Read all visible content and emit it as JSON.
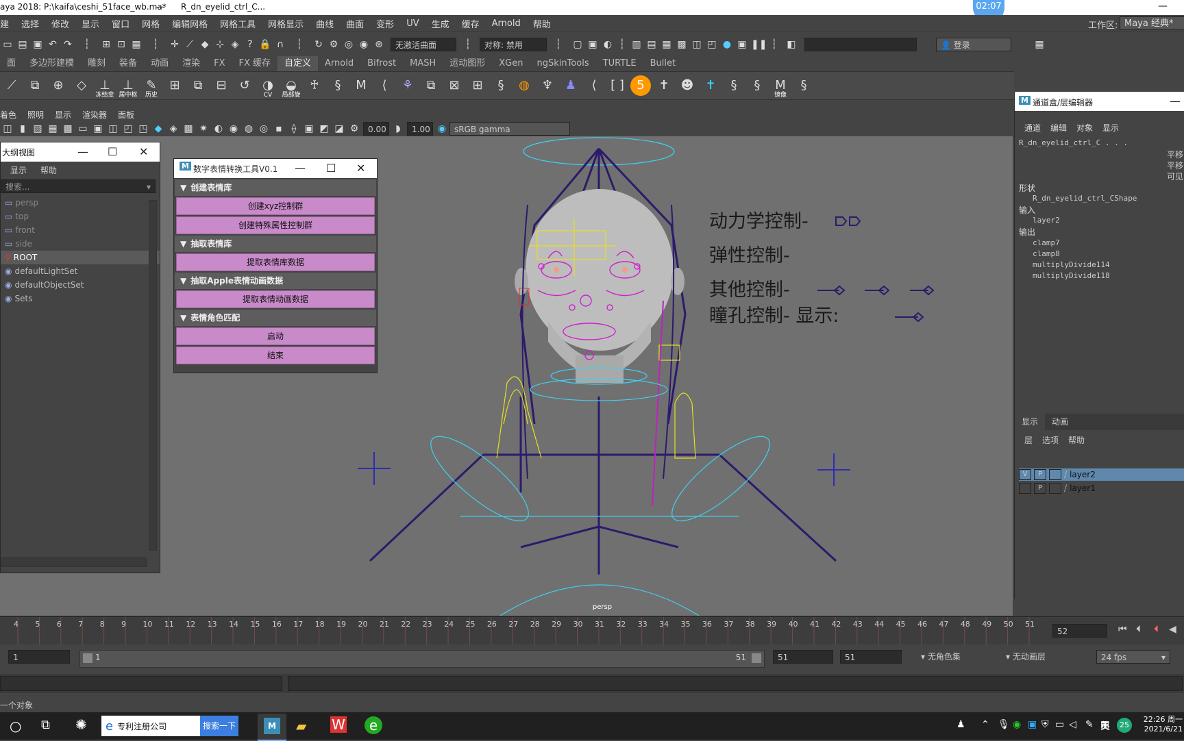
{
  "titlebar": {
    "app": "aya 2018: P:\\kaifa\\ceshi_51face_wb.ma*",
    "sep": "---",
    "node": "R_dn_eyelid_ctrl_C...",
    "workspace_label": "工作区:",
    "workspace_value": "Maya 经典*",
    "clock": "02:07"
  },
  "menubar": {
    "items": [
      "建",
      "选择",
      "修改",
      "显示",
      "窗口",
      "网格",
      "编辑网格",
      "网格工具",
      "网格显示",
      "曲线",
      "曲面",
      "变形",
      "UV",
      "生成",
      "缓存",
      "Arnold",
      "帮助"
    ]
  },
  "statusline": {
    "live_surface": "无激活曲面",
    "symmetry": "对称: 禁用",
    "login": "登录"
  },
  "shelf_tabs": {
    "items": [
      "面",
      "多边形建模",
      "雕刻",
      "装备",
      "动画",
      "渲染",
      "FX",
      "FX 缓存",
      "自定义",
      "Arnold",
      "Bifrost",
      "MASH",
      "运动图形",
      "XGen",
      "ngSkinTools",
      "TURTLE",
      "Bullet"
    ],
    "active_index": 8
  },
  "shelf": {
    "labels": {
      "freeze": "冻结变",
      "center": "居中枢",
      "history": "历史",
      "cv": "CV",
      "local": "局部旋",
      "five": "5",
      "mirror": "镜像"
    }
  },
  "panel_menu": {
    "items": [
      "着色",
      "照明",
      "显示",
      "渲染器",
      "面板"
    ]
  },
  "view_toolbar": {
    "value1": "0.00",
    "value2": "1.00",
    "colorspace": "sRGB gamma"
  },
  "viewport": {
    "camera": "persp",
    "labels": {
      "dynamics": "动力学控制-",
      "elastic": "弹性控制-",
      "other": "其他控制-",
      "pupil": "瞳孔控制- 显示:"
    }
  },
  "outliner": {
    "title": "大纲视图",
    "menu": [
      "显示",
      "帮助"
    ],
    "search_placeholder": "搜索...",
    "items": [
      "persp",
      "top",
      "front",
      "side",
      "ROOT",
      "defaultLightSet",
      "defaultObjectSet",
      "Sets"
    ],
    "selected_index": 4
  },
  "tool": {
    "title": "数字表情转换工具V0.1",
    "sections": [
      {
        "title": "创建表情库",
        "buttons": [
          "创建xyz控制群",
          "创建特殊属性控制群"
        ]
      },
      {
        "title": "抽取表情库",
        "buttons": [
          "提取表情库数据"
        ]
      },
      {
        "title": "抽取Apple表情动画数据",
        "buttons": [
          "提取表情动画数据"
        ]
      },
      {
        "title": "表情角色匹配",
        "buttons": [
          "启动",
          "结束"
        ]
      }
    ]
  },
  "channel": {
    "title": "通道盒/层编辑器",
    "menu": [
      "通道",
      "编辑",
      "对象",
      "显示"
    ],
    "node": "R_dn_eyelid_ctrl_C . . .",
    "attrs": [
      "平移",
      "平移",
      "可见"
    ],
    "shape_label": "形状",
    "shape": "R_dn_eyelid_ctrl_CShape",
    "input_label": "输入",
    "inputs": [
      "layer2"
    ],
    "output_label": "输出",
    "outputs": [
      "clamp7",
      "clamp8",
      "multiplyDivide114",
      "multiplyDivide118"
    ],
    "layer_tabs": [
      "显示",
      "动画"
    ],
    "layer_menu": [
      "层",
      "选项",
      "帮助"
    ],
    "layers": [
      {
        "v": "V",
        "p": "P",
        "name": "layer2",
        "selected": true
      },
      {
        "v": "",
        "p": "P",
        "name": "layer1",
        "selected": false
      }
    ]
  },
  "timeline": {
    "start": 4,
    "end": 51,
    "current": "52"
  },
  "range": {
    "start": "1",
    "inner_start": "1",
    "inner_end": "51",
    "end1": "51",
    "end2": "51",
    "charset": "无角色集",
    "animlayer": "无动画层",
    "fps": "24 fps"
  },
  "helpline": {
    "text": "一个对象"
  },
  "taskbar": {
    "search_text": "专利注册公司",
    "search_button": "搜索一下",
    "lang": "英",
    "badge": "25",
    "time": "22:26 周一",
    "date": "2021/6/21"
  }
}
